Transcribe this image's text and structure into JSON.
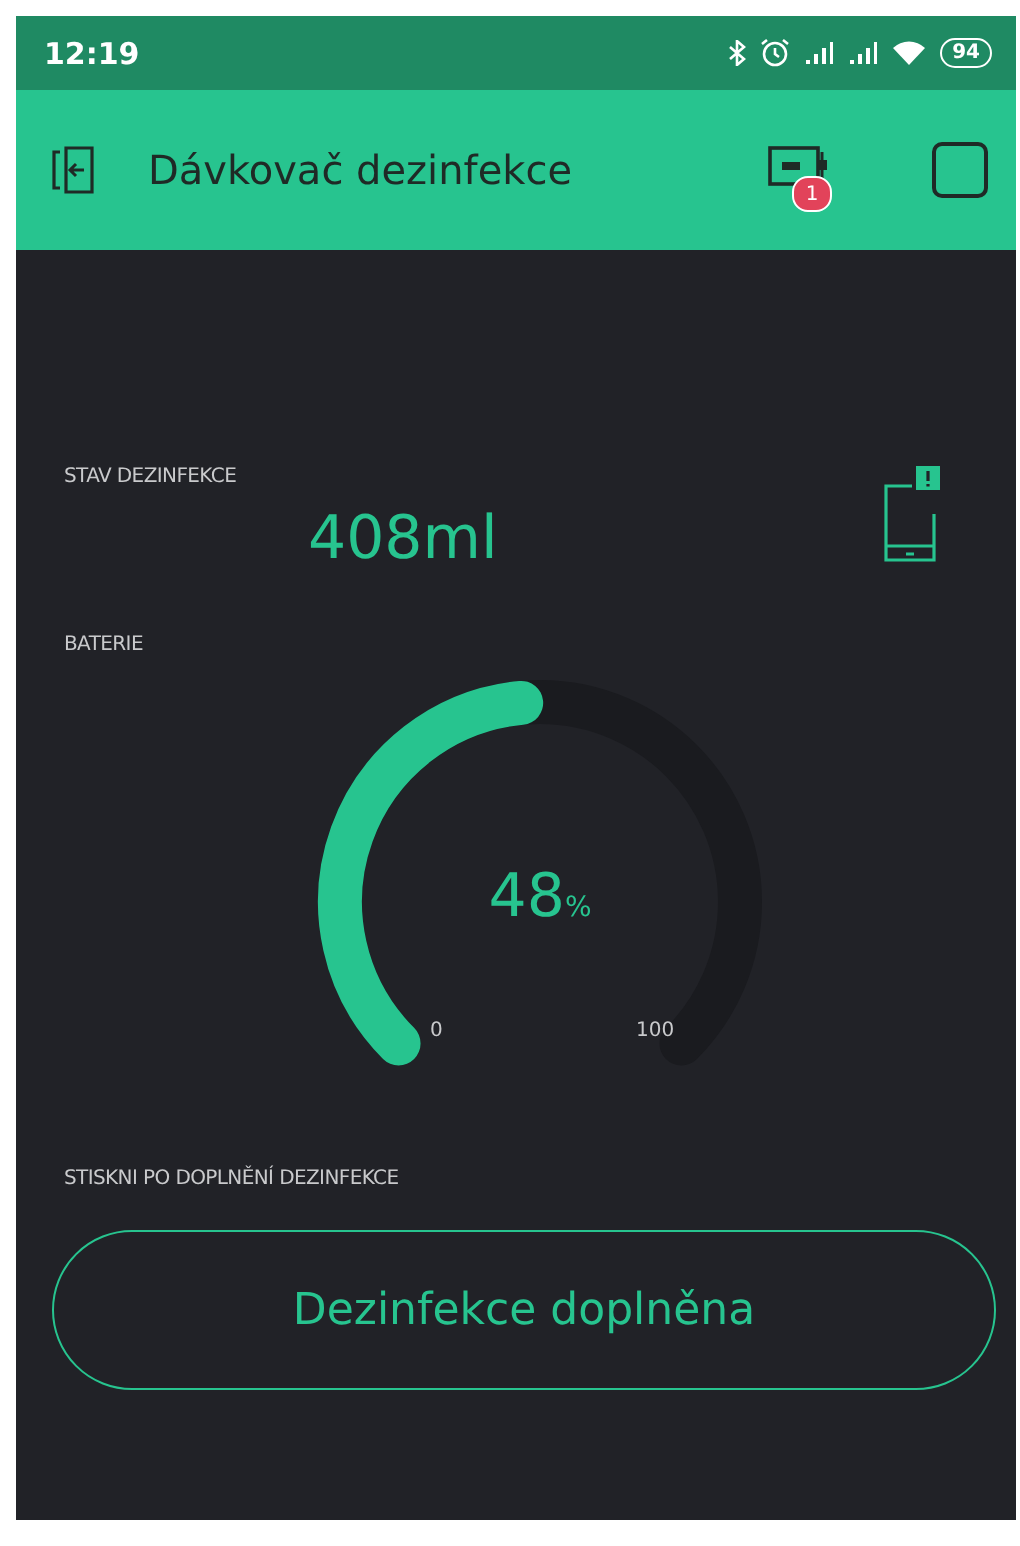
{
  "status_bar": {
    "time": "12:19",
    "battery": "94"
  },
  "app_bar": {
    "title": "Dávkovač dezinfekce",
    "device_badge": "1"
  },
  "display": {
    "label": "STAV DEZINFEKCE",
    "value": "408ml"
  },
  "gauge": {
    "label": "BATERIE",
    "value": "48",
    "unit": "%",
    "min": "0",
    "max": "100"
  },
  "action": {
    "label": "STISKNI PO DOPLNĚNÍ DEZINFEKCE",
    "button": "Dezinfekce doplněna"
  }
}
